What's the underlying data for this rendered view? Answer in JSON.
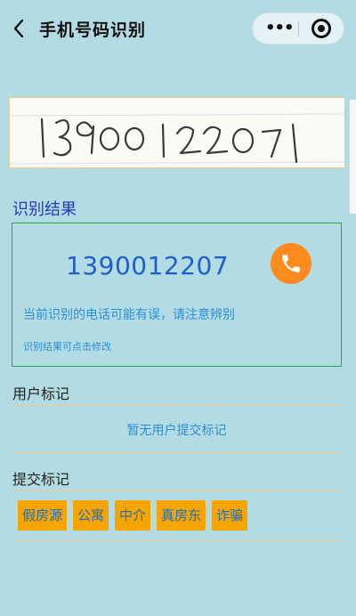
{
  "nav": {
    "title": "手机号码识别",
    "back_icon": "chevron-left-icon",
    "more_icon": "more-dots-icon",
    "close_icon": "target-circle-icon"
  },
  "photo": {
    "handwritten_text": "13900122071"
  },
  "result": {
    "heading": "识别结果",
    "phone_number": "1390012207",
    "warning": "当前识别的电话可能有误，请注意辨别",
    "hint": "识别结果可点击修改",
    "call_icon": "phone-icon",
    "call_color": "#ff8a1e"
  },
  "user_marks": {
    "heading": "用户标记",
    "empty_text": "暂无用户提交标记"
  },
  "submit_marks": {
    "heading": "提交标记",
    "tags": [
      "假房源",
      "公寓",
      "中介",
      "真房东",
      "诈骗"
    ],
    "tag_color": "#f5a400"
  },
  "colors": {
    "background": "#b3dbe3",
    "accent_blue": "#1f5fc9",
    "green_border": "#27a745"
  }
}
